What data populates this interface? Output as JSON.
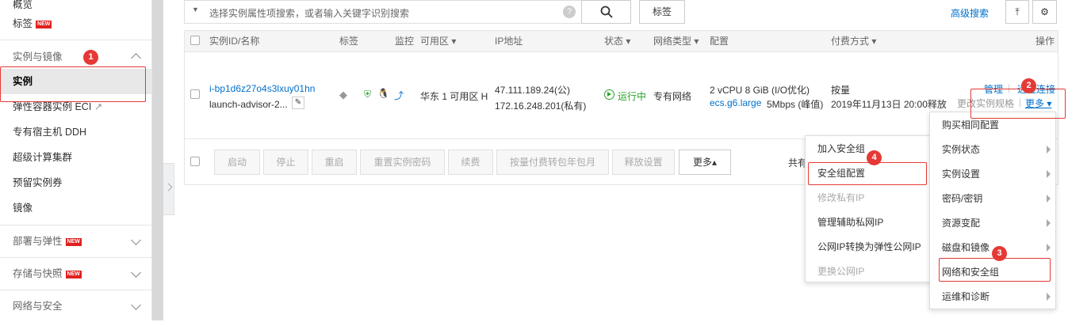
{
  "sidebar": {
    "overview": "概览",
    "tags": "标签",
    "new_badge": "NEW",
    "group_instances": "实例与镜像",
    "items": [
      "实例",
      "弹性容器实例 ECI",
      "专有宿主机 DDH",
      "超级计算集群",
      "预留实例券",
      "镜像"
    ],
    "groups": [
      "部署与弹性",
      "存储与快照",
      "网络与安全"
    ]
  },
  "toolbar": {
    "search_placeholder": "选择实例属性项搜索，或者输入关键字识别搜索",
    "tag_button": "标签",
    "advanced_search": "高级搜索"
  },
  "table": {
    "headers": [
      "实例ID/名称",
      "标签",
      "监控",
      "可用区 ▾",
      "IP地址",
      "状态 ▾",
      "网络类型 ▾",
      "配置",
      "付费方式 ▾",
      "操作"
    ],
    "row": {
      "instance_id": "i-bp1d6z27o4s3lxuy01hn",
      "instance_name": "launch-advisor-2...",
      "zone": "华东 1 可用区 H",
      "ip_public": "47.111.189.24(公)",
      "ip_private": "172.16.248.201(私有)",
      "status": "运行中",
      "network": "专有网络",
      "config_line1": "2 vCPU 8 GiB (I/O优化)",
      "config_type": "ecs.g6.large",
      "config_bw": "5Mbps (峰值)",
      "billing": "按量",
      "release": "2019年11月13日 20:00释放",
      "op_manage": "管理",
      "op_connect": "远程连接",
      "op_change": "更改实例规格",
      "op_more": "更多 ▾"
    }
  },
  "bottom_buttons": [
    "启动",
    "停止",
    "重启",
    "重置实例密码",
    "续费",
    "按量付费转包年包月",
    "释放设置",
    "更多▴"
  ],
  "bottom_total": "共有",
  "menu_main": [
    "购买相同配置",
    "实例状态",
    "实例设置",
    "密码/密钥",
    "资源变配",
    "磁盘和镜像",
    "网络和安全组",
    "运维和诊断"
  ],
  "menu_sub": [
    "加入安全组",
    "安全组配置",
    "修改私有IP",
    "管理辅助私网IP",
    "公网IP转换为弹性公网IP",
    "更换公网IP"
  ],
  "annotations": [
    "1",
    "2",
    "3",
    "4"
  ],
  "colors": {
    "accent": "#0070cc",
    "annotation": "#e53935",
    "running": "#2aa12a"
  }
}
